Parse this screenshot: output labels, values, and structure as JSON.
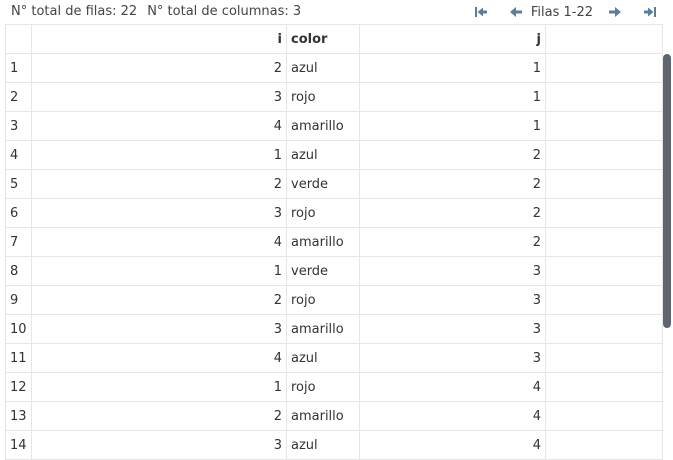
{
  "summary": {
    "rows_label": "N° total de filas: 22",
    "cols_label": "N° total de columnas: 3"
  },
  "pager": {
    "label": "Filas 1-22",
    "icons": {
      "first": "first-page-icon",
      "prev": "previous-page-icon",
      "next": "next-page-icon",
      "last": "last-page-icon"
    },
    "icon_color": "#5b7e9e"
  },
  "table": {
    "headers": {
      "index": "",
      "i": "i",
      "color": "color",
      "j": "j"
    },
    "rows": [
      {
        "index": "1",
        "i": "2",
        "color": "azul",
        "j": "1"
      },
      {
        "index": "2",
        "i": "3",
        "color": "rojo",
        "j": "1"
      },
      {
        "index": "3",
        "i": "4",
        "color": "amarillo",
        "j": "1"
      },
      {
        "index": "4",
        "i": "1",
        "color": "azul",
        "j": "2"
      },
      {
        "index": "5",
        "i": "2",
        "color": "verde",
        "j": "2"
      },
      {
        "index": "6",
        "i": "3",
        "color": "rojo",
        "j": "2"
      },
      {
        "index": "7",
        "i": "4",
        "color": "amarillo",
        "j": "2"
      },
      {
        "index": "8",
        "i": "1",
        "color": "verde",
        "j": "3"
      },
      {
        "index": "9",
        "i": "2",
        "color": "rojo",
        "j": "3"
      },
      {
        "index": "10",
        "i": "3",
        "color": "amarillo",
        "j": "3"
      },
      {
        "index": "11",
        "i": "4",
        "color": "azul",
        "j": "3"
      },
      {
        "index": "12",
        "i": "1",
        "color": "rojo",
        "j": "4"
      },
      {
        "index": "13",
        "i": "2",
        "color": "amarillo",
        "j": "4"
      },
      {
        "index": "14",
        "i": "3",
        "color": "azul",
        "j": "4"
      }
    ]
  }
}
